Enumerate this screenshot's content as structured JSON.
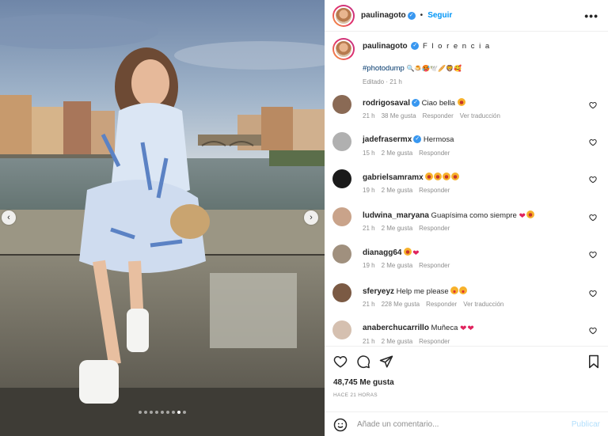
{
  "post": {
    "username": "paulinagoto",
    "follow_label": "Seguir",
    "more_label": "•••",
    "caption_text": "F l o r e n c i a",
    "hashtag": "#photodump",
    "caption_emojis": "🔍🍮🥵🕊️🥖🦁🥰",
    "edited": "Editado",
    "edited_ago": "21 h"
  },
  "comments": [
    {
      "user": "rodrigosaval",
      "verified": true,
      "text": "Ciao bella",
      "emojis": [
        "o"
      ],
      "time": "21 h",
      "likes": "38 Me gusta",
      "reply": "Responder",
      "translate": "Ver traducción"
    },
    {
      "user": "jadefrasermx",
      "verified": true,
      "text": "Hermosa",
      "emojis": [],
      "time": "15 h",
      "likes": "2 Me gusta",
      "reply": "Responder",
      "translate": ""
    },
    {
      "user": "gabrielsamramx",
      "verified": false,
      "text": "",
      "emojis": [
        "o",
        "o",
        "o",
        "o"
      ],
      "time": "19 h",
      "likes": "2 Me gusta",
      "reply": "Responder",
      "translate": ""
    },
    {
      "user": "ludwina_maryana",
      "verified": false,
      "text": "Guapísima como siempre",
      "emojis": [
        "h",
        "o"
      ],
      "time": "21 h",
      "likes": "2 Me gusta",
      "reply": "Responder",
      "translate": ""
    },
    {
      "user": "dianagg64",
      "verified": false,
      "text": "",
      "emojis": [
        "o",
        "h"
      ],
      "time": "19 h",
      "likes": "2 Me gusta",
      "reply": "Responder",
      "translate": ""
    },
    {
      "user": "sferyeyz",
      "verified": false,
      "text": "Help me please",
      "emojis": [
        "l",
        "l"
      ],
      "time": "21 h",
      "likes": "228 Me gusta",
      "reply": "Responder",
      "translate": "Ver traducción"
    },
    {
      "user": "anaberchucarrillo",
      "verified": false,
      "text": "Muñeca",
      "emojis": [
        "h",
        "h"
      ],
      "time": "21 h",
      "likes": "2 Me gusta",
      "reply": "Responder",
      "translate": ""
    }
  ],
  "actions": {
    "likes": "48,745 Me gusta",
    "ago": "HACE 21 HORAS"
  },
  "add_comment": {
    "placeholder": "Añade un comentario...",
    "publish": "Publicar"
  },
  "carousel": {
    "total": 9,
    "active_index": 7
  },
  "colors": {
    "accent": "#0095f6",
    "verified": "#3897f0",
    "heart": "#e0245e"
  },
  "icons": [
    "heart-icon",
    "comment-icon",
    "share-icon",
    "bookmark-icon",
    "emoji-icon",
    "chevron-left-icon",
    "chevron-right-icon"
  ]
}
